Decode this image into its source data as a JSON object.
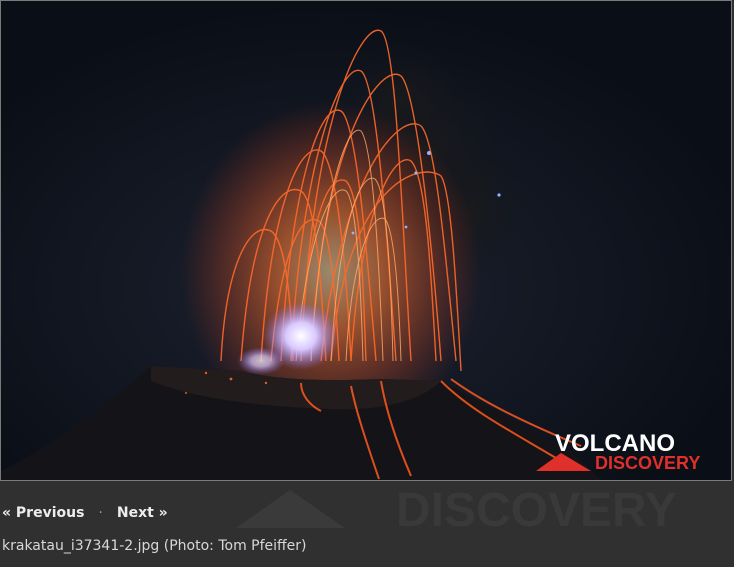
{
  "photo": {
    "description_icon": "volcano-eruption-photo",
    "logo": {
      "line1": "VOLCANO",
      "line2": "DISCOVERY"
    }
  },
  "watermark": {
    "text": "DISCOVERY"
  },
  "navigation": {
    "previous_label": "« Previous",
    "separator": "·",
    "next_label": "Next »"
  },
  "caption": {
    "text": "krakatau_i37341-2.jpg (Photo: Tom Pfeiffer)"
  },
  "colors": {
    "page_background": "#303030",
    "lava_orange": "#ff5a1e",
    "logo_red": "#e0302a",
    "link_text": "#ededed"
  }
}
